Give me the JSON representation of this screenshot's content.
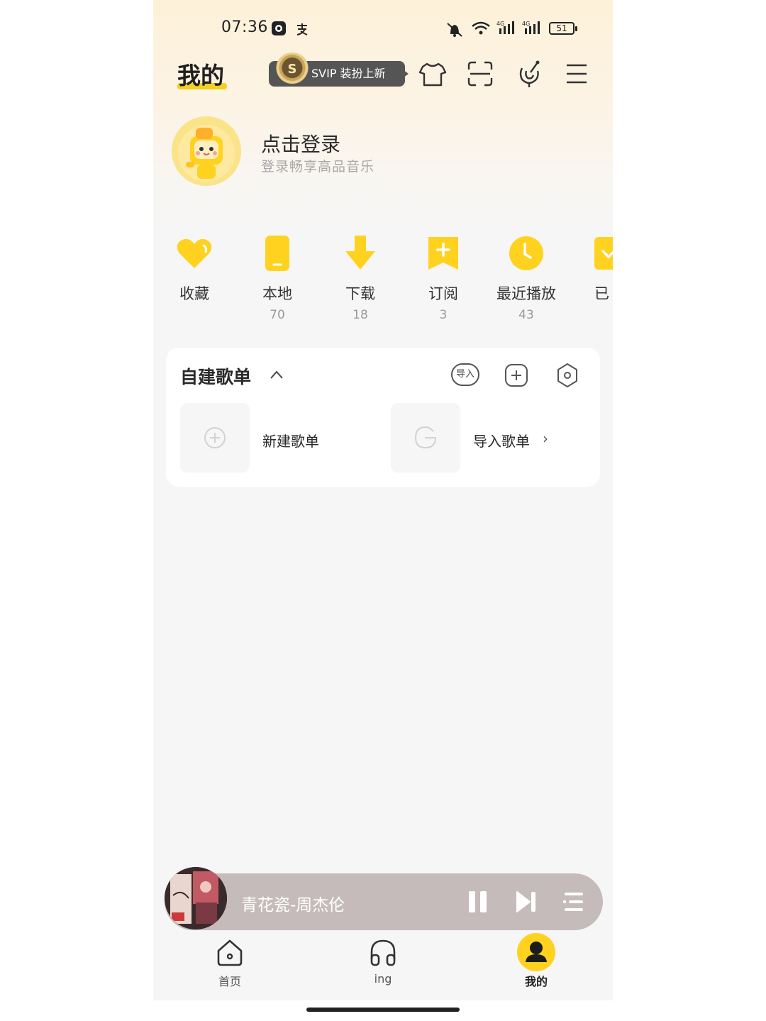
{
  "status_bar": {
    "time": "07:36",
    "battery": "51"
  },
  "header": {
    "title": "我的",
    "svip_label": "SVIP 装扮上新",
    "svip_badge": "S"
  },
  "profile": {
    "login_title": "点击登录",
    "login_subtitle": "登录畅享高品音乐"
  },
  "quick_actions": [
    {
      "label": "收藏",
      "count": ""
    },
    {
      "label": "本地",
      "count": "70"
    },
    {
      "label": "下载",
      "count": "18"
    },
    {
      "label": "订阅",
      "count": "3"
    },
    {
      "label": "最近播放",
      "count": "43"
    },
    {
      "label": "已",
      "count": ""
    }
  ],
  "playlist_card": {
    "title": "自建歌单",
    "import_btn": "导入",
    "new_label": "新建歌单",
    "import_label": "导入歌单",
    "import_arrow": "›"
  },
  "player": {
    "song": "青花瓷-周杰伦"
  },
  "bottom_nav": [
    {
      "label": "首页"
    },
    {
      "label": "ing"
    },
    {
      "label": "我的"
    }
  ],
  "colors": {
    "accent": "#f5cf21",
    "player_bg": "#c6bbbb",
    "bg": "#f6f6f6"
  }
}
